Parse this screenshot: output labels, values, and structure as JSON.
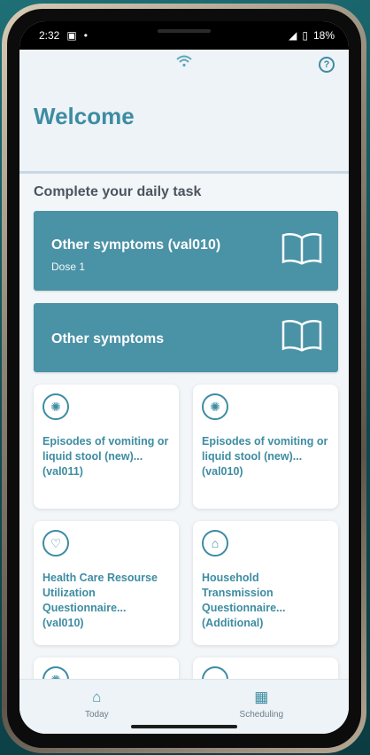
{
  "status_bar": {
    "time": "2:32",
    "battery": "18%"
  },
  "header": {
    "title": "Welcome"
  },
  "section": {
    "title": "Complete your daily task"
  },
  "tasks": [
    {
      "title": "Other symptoms (val010)",
      "subtitle": "Dose 1"
    },
    {
      "title": "Other symptoms",
      "subtitle": ""
    }
  ],
  "cards": [
    {
      "label": "Episodes of vomiting or liquid stool (new)... (val011)",
      "icon": "virus-icon"
    },
    {
      "label": "Episodes of vomiting or liquid stool (new)... (val010)",
      "icon": "virus-icon"
    },
    {
      "label": "Health Care Resourse Utilization Questionnaire... (val010)",
      "icon": "heart-icon"
    },
    {
      "label": "Household Transmission Questionnaire... (Additional)",
      "icon": "house-icon"
    }
  ],
  "bottom_nav": [
    {
      "label": "Today",
      "icon": "home-icon"
    },
    {
      "label": "Scheduling",
      "icon": "calendar-icon"
    }
  ],
  "colors": {
    "accent": "#3d8ca2",
    "task_bg": "#4a92a6",
    "screen_bg": "#f3f6f9"
  }
}
